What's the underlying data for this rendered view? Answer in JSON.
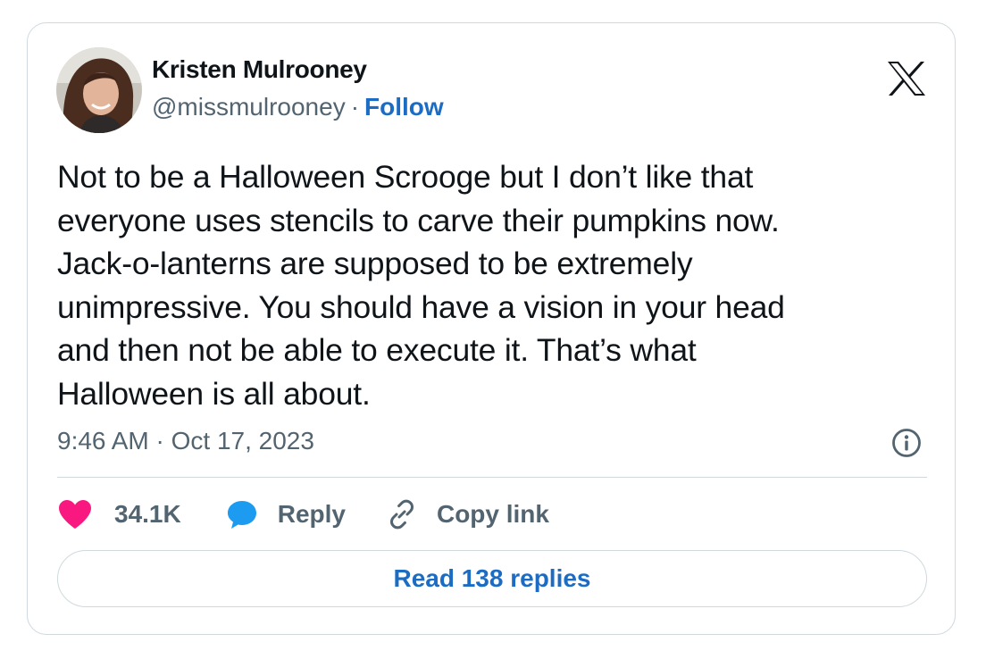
{
  "author": {
    "display_name": "Kristen Mulrooney",
    "handle": "@missmulrooney",
    "separator": "·",
    "follow_label": "Follow"
  },
  "tweet": {
    "lines": [
      "Not to be a Halloween Scrooge but I don’t like that",
      "everyone uses stencils to carve their pumpkins now.",
      "Jack-o-lanterns are supposed to be extremely",
      "unimpressive. You should have a vision in your head",
      "and then not be able to execute it.  That’s what",
      "Halloween is all about."
    ],
    "timestamp": "9:46 AM · Oct 17, 2023"
  },
  "actions": {
    "like_count": "34.1K",
    "reply_label": "Reply",
    "copy_link_label": "Copy link"
  },
  "read_replies_label": "Read 138 replies",
  "icons": {
    "brand": "x-logo-icon",
    "like": "heart-icon",
    "reply": "speech-bubble-icon",
    "copy": "link-icon",
    "info": "info-icon"
  },
  "colors": {
    "like": "#f91880",
    "reply": "#1d9bf0",
    "link_text": "#1d6cc4",
    "secondary_text": "#536471",
    "border": "#cfd9de"
  }
}
